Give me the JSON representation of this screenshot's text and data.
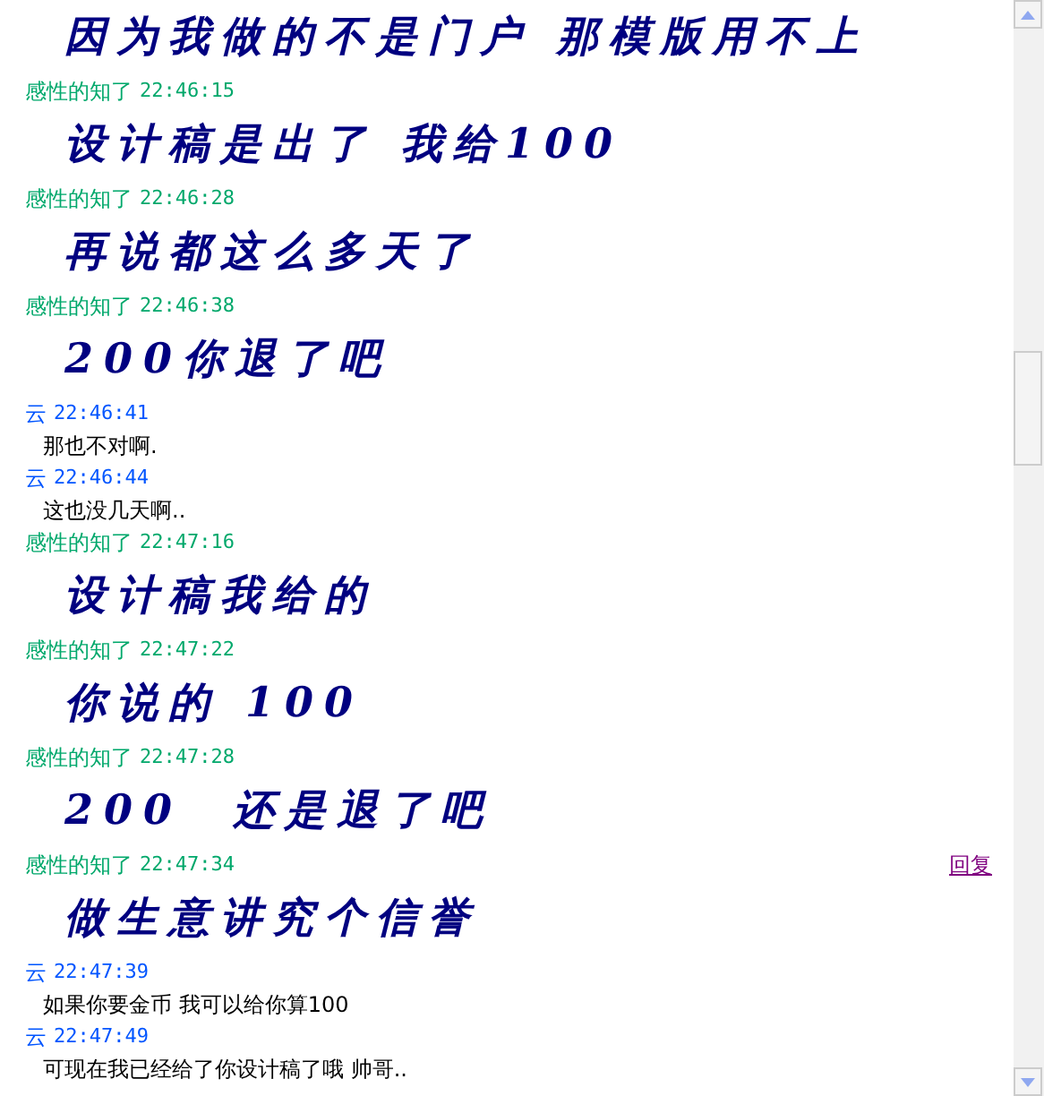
{
  "messages": [
    {
      "kind": "styled",
      "text": "因为我做的不是门户 那模版用不上"
    },
    {
      "sender": "感性的知了",
      "time": "22:46:15",
      "color": "#00a86b",
      "kind": "styled",
      "text": "设计稿是出了 我给100"
    },
    {
      "sender": "感性的知了",
      "time": "22:46:28",
      "color": "#00a86b",
      "kind": "styled",
      "text": "再说都这么多天了"
    },
    {
      "sender": "感性的知了",
      "time": "22:46:38",
      "color": "#00a86b",
      "kind": "styled",
      "text": "200你退了吧"
    },
    {
      "sender": "云",
      "time": "22:46:41",
      "color": "#0055ff",
      "kind": "plain",
      "text": "那也不对啊."
    },
    {
      "sender": "云",
      "time": "22:46:44",
      "color": "#0055ff",
      "kind": "plain",
      "text": "这也没几天啊.."
    },
    {
      "sender": "感性的知了",
      "time": "22:47:16",
      "color": "#00a86b",
      "kind": "styled",
      "text": "设计稿我给的"
    },
    {
      "sender": "感性的知了",
      "time": "22:47:22",
      "color": "#00a86b",
      "kind": "styled",
      "text": "你说的 100"
    },
    {
      "sender": "感性的知了",
      "time": "22:47:28",
      "color": "#00a86b",
      "kind": "styled",
      "text": "200  还是退了吧"
    },
    {
      "sender": "感性的知了",
      "time": "22:47:34",
      "color": "#00a86b",
      "reply": "回复",
      "kind": "styled",
      "text": "做生意讲究个信誉"
    },
    {
      "sender": "云",
      "time": "22:47:39",
      "color": "#0055ff",
      "kind": "plain",
      "text": "如果你要金币 我可以给你算100"
    },
    {
      "sender": "云",
      "time": "22:47:49",
      "color": "#0055ff",
      "kind": "plain",
      "text": "可现在我已经给了你设计稿了哦 帅哥.."
    }
  ]
}
